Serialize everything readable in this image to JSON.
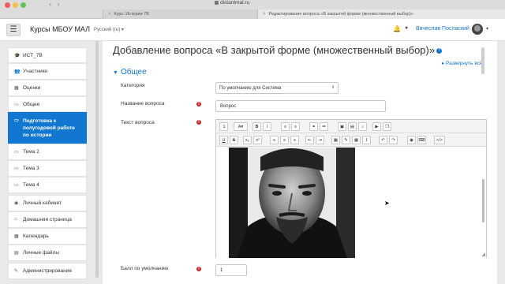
{
  "browser": {
    "url": "distantmal.ru",
    "tabs": [
      {
        "label": "Курс: История 7В",
        "active": false
      },
      {
        "label": "Редактирование вопроса «В закрытой форме (множественный выбор)»",
        "active": true
      }
    ]
  },
  "navbar": {
    "menu_icon": "☰",
    "site_name": "Курсы МБОУ МАЛ",
    "language": "Русский (ru) ▾",
    "user_name": "Вячеслав Послаский"
  },
  "sidebar": {
    "items": [
      {
        "label": "ИСТ_7В",
        "icon": "cap-icon",
        "glyph": "🎓"
      },
      {
        "label": "Участники",
        "icon": "users-icon",
        "glyph": "👥"
      },
      {
        "label": "Оценки",
        "icon": "grades-icon",
        "glyph": "▦"
      },
      {
        "label": "Общее",
        "icon": "folder-icon",
        "glyph": "▭"
      },
      {
        "label": "Подготовка к полугодовой работе по истории",
        "icon": "folder-icon",
        "glyph": "▭",
        "active": true
      },
      {
        "label": "Тема 2",
        "icon": "folder-icon",
        "glyph": "▭"
      },
      {
        "label": "Тема 3",
        "icon": "folder-icon",
        "glyph": "▭"
      },
      {
        "label": "Тема 4",
        "icon": "folder-icon",
        "glyph": "▭"
      },
      {
        "label": "Личный кабинет",
        "icon": "dashboard-icon",
        "glyph": "◉"
      },
      {
        "label": "Домашняя страница",
        "icon": "home-icon",
        "glyph": "⌂"
      },
      {
        "label": "Календарь",
        "icon": "calendar-icon",
        "glyph": "▦"
      },
      {
        "label": "Личные файлы",
        "icon": "file-icon",
        "glyph": "▤"
      },
      {
        "label": "Администрирование",
        "icon": "wrench-icon",
        "glyph": "✎"
      }
    ]
  },
  "main": {
    "title": "Добавление вопроса «В закрытой форме (множественный выбор)»",
    "expand_all": "Развернуть всё",
    "section": "Общее",
    "fields": {
      "category_label": "Категория",
      "category_value": "По умолчанию для Система",
      "name_label": "Название вопроса",
      "name_value": "Вопрос",
      "text_label": "Текст вопроса",
      "default_mark_label": "Балл по умолчанию",
      "default_mark_value": "1"
    }
  },
  "editor": {
    "toolbar1": [
      "↴",
      "A▾",
      "B",
      "I",
      "≡",
      "≡",
      "⚭",
      "⚮",
      "▣",
      "▤",
      "♪",
      "▶",
      "❐"
    ],
    "toolbar2": [
      "U",
      "S",
      "x₂",
      "x²",
      "≡",
      "≡",
      "≡",
      "⇤",
      "⇥",
      "▦",
      "✎",
      "▦",
      "Ⅰ",
      "↶",
      "↷",
      "◉",
      "⌨",
      "</>"
    ]
  },
  "colors": {
    "accent": "#1177d1",
    "required": "#c92b2b"
  }
}
